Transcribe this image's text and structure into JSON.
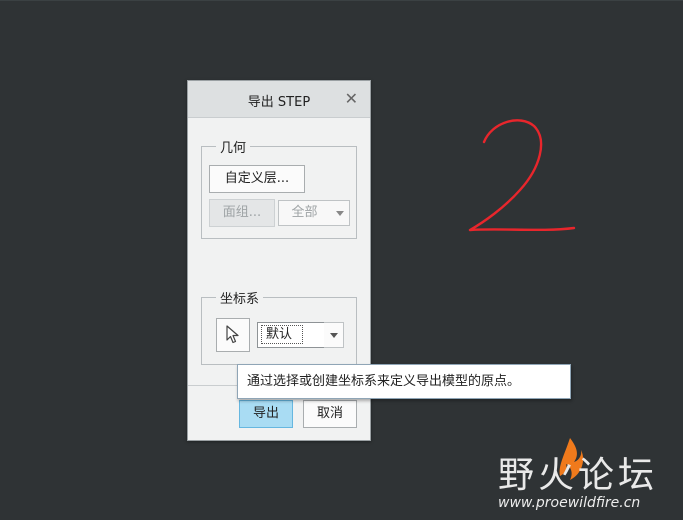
{
  "dialog": {
    "title": "导出 STEP",
    "close_glyph": "✕",
    "geometry_group": {
      "legend": "几何",
      "custom_layers_label": "自定义层...",
      "quilts_label": "面组...",
      "scope_value": "全部"
    },
    "csys_group": {
      "legend": "坐标系",
      "csys_value": "默认"
    },
    "export_label": "导出",
    "cancel_label": "取消"
  },
  "tooltip": {
    "text": "通过选择或创建坐标系来定义导出模型的原点。"
  },
  "annotation": {
    "text": "2",
    "color": "#e8262c"
  },
  "watermark": {
    "name": "野火论坛",
    "url": "www.proewildfire.cn",
    "flame_color": "#f07a1c"
  }
}
